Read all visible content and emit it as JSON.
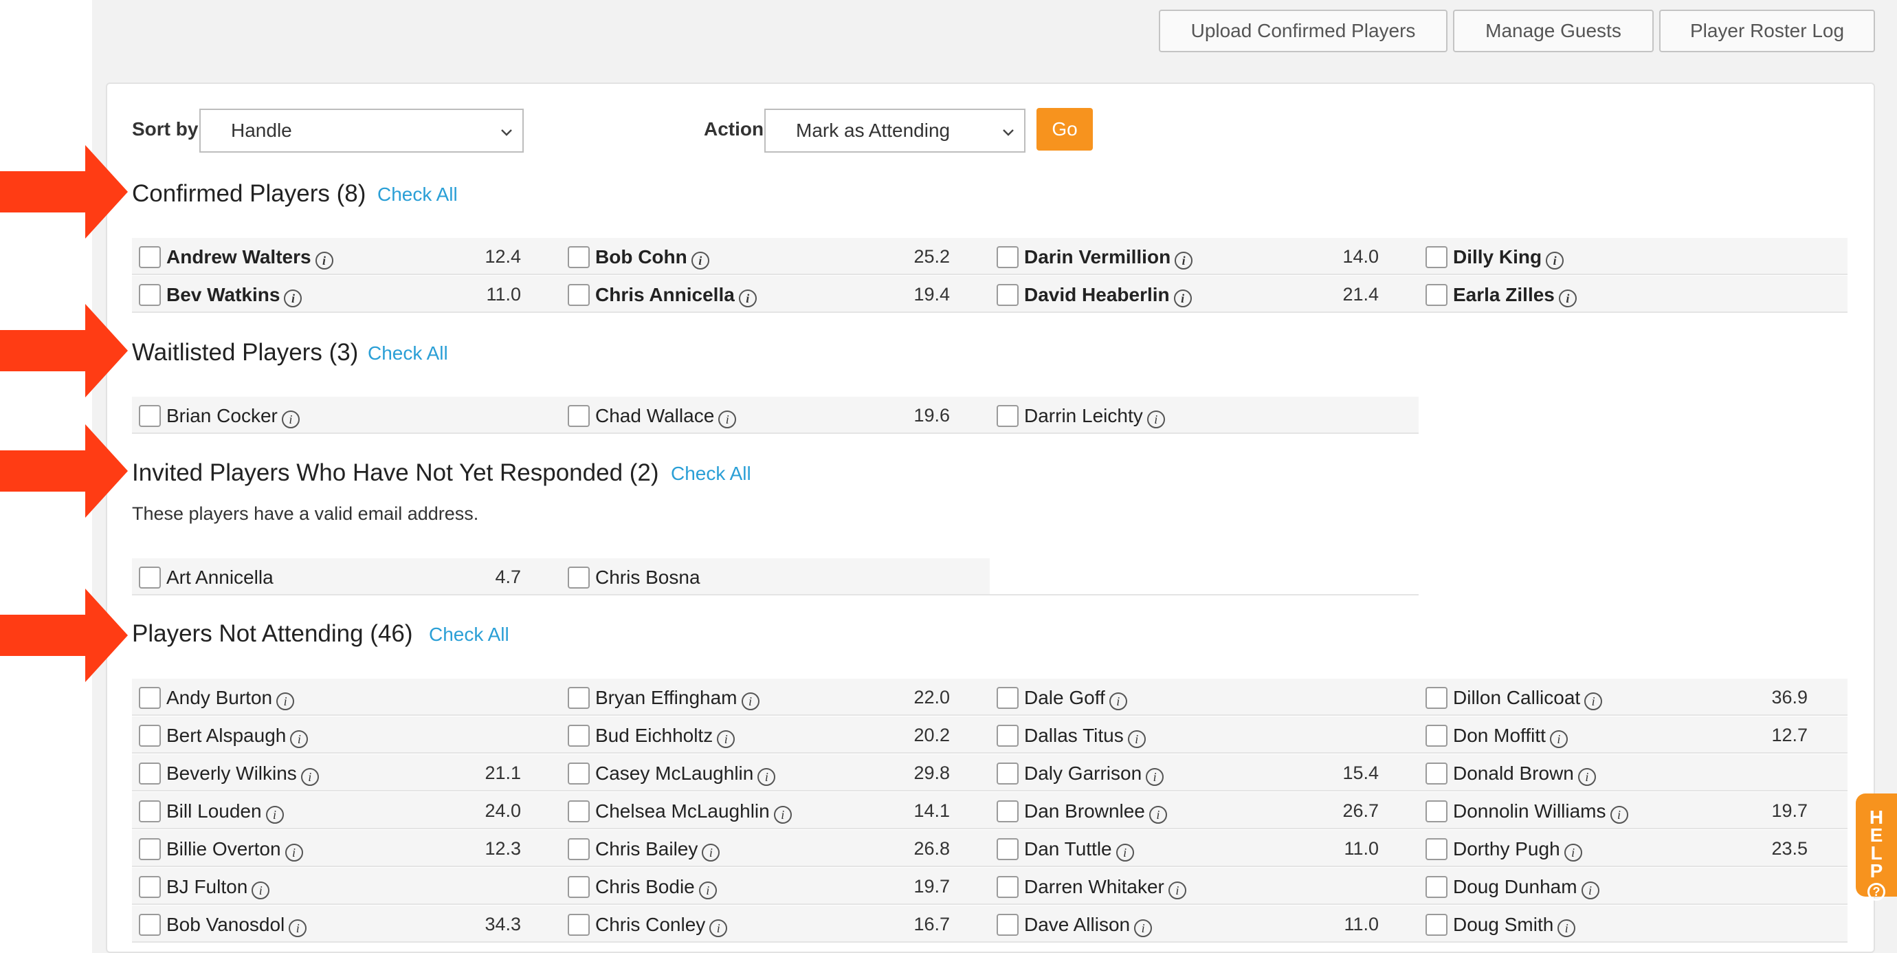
{
  "toolbar": {
    "upload_label": "Upload Confirmed Players",
    "guests_label": "Manage Guests",
    "log_label": "Player Roster Log"
  },
  "controls": {
    "sort_label": "Sort by",
    "sort_value": "Handle",
    "action_label": "Action",
    "action_value": "Mark as Attending",
    "go_label": "Go"
  },
  "check_all_label": "Check All",
  "info_glyph": "i",
  "accent_color": "#f7931e",
  "link_color": "#2a9fd6",
  "arrow_color": "#ff3c14",
  "sections": {
    "confirmed": {
      "title": "Confirmed Players (8)",
      "columns": [
        [
          {
            "name": "Andrew Walters",
            "hcp": "12.4",
            "info": true
          },
          {
            "name": "Bev Watkins",
            "hcp": "11.0",
            "info": true
          }
        ],
        [
          {
            "name": "Bob Cohn",
            "hcp": "25.2",
            "info": true
          },
          {
            "name": "Chris Annicella",
            "hcp": "19.4",
            "info": true
          }
        ],
        [
          {
            "name": "Darin Vermillion",
            "hcp": "14.0",
            "info": true
          },
          {
            "name": "David Heaberlin",
            "hcp": "21.4",
            "info": true
          }
        ],
        [
          {
            "name": "Dilly King",
            "hcp": "",
            "info": true
          },
          {
            "name": "Earla Zilles",
            "hcp": "",
            "info": true
          }
        ]
      ]
    },
    "waitlisted": {
      "title": "Waitlisted Players (3)",
      "columns": [
        [
          {
            "name": "Brian Cocker",
            "hcp": "",
            "info": true
          }
        ],
        [
          {
            "name": "Chad Wallace",
            "hcp": "19.6",
            "info": true
          }
        ],
        [
          {
            "name": "Darrin Leichty",
            "hcp": "",
            "info": true
          }
        ]
      ]
    },
    "invited": {
      "title": "Invited Players Who Have Not Yet Responded (2)",
      "note": "These players have a valid email address.",
      "columns": [
        [
          {
            "name": "Art Annicella",
            "hcp": "4.7",
            "info": false
          }
        ],
        [
          {
            "name": "Chris Bosna",
            "hcp": "",
            "info": false
          }
        ]
      ]
    },
    "not_attending": {
      "title": "Players Not Attending (46)",
      "columns": [
        [
          {
            "name": "Andy Burton",
            "hcp": "",
            "info": true
          },
          {
            "name": "Bert Alspaugh",
            "hcp": "",
            "info": true
          },
          {
            "name": "Beverly Wilkins",
            "hcp": "21.1",
            "info": true
          },
          {
            "name": "Bill Louden",
            "hcp": "24.0",
            "info": true
          },
          {
            "name": "Billie Overton",
            "hcp": "12.3",
            "info": true
          },
          {
            "name": "BJ Fulton",
            "hcp": "",
            "info": true
          },
          {
            "name": "Bob Vanosdol",
            "hcp": "34.3",
            "info": true
          }
        ],
        [
          {
            "name": "Bryan Effingham",
            "hcp": "22.0",
            "info": true
          },
          {
            "name": "Bud Eichholtz",
            "hcp": "20.2",
            "info": true
          },
          {
            "name": "Casey McLaughlin",
            "hcp": "29.8",
            "info": true
          },
          {
            "name": "Chelsea McLaughlin",
            "hcp": "14.1",
            "info": true
          },
          {
            "name": "Chris Bailey",
            "hcp": "26.8",
            "info": true
          },
          {
            "name": "Chris Bodie",
            "hcp": "19.7",
            "info": true
          },
          {
            "name": "Chris Conley",
            "hcp": "16.7",
            "info": true
          }
        ],
        [
          {
            "name": "Dale Goff",
            "hcp": "",
            "info": true
          },
          {
            "name": "Dallas Titus",
            "hcp": "",
            "info": true
          },
          {
            "name": "Daly Garrison",
            "hcp": "15.4",
            "info": true
          },
          {
            "name": "Dan Brownlee",
            "hcp": "26.7",
            "info": true
          },
          {
            "name": "Dan Tuttle",
            "hcp": "11.0",
            "info": true
          },
          {
            "name": "Darren Whitaker",
            "hcp": "",
            "info": true
          },
          {
            "name": "Dave Allison",
            "hcp": "11.0",
            "info": true
          }
        ],
        [
          {
            "name": "Dillon Callicoat",
            "hcp": "36.9",
            "info": true
          },
          {
            "name": "Don Moffitt",
            "hcp": "12.7",
            "info": true
          },
          {
            "name": "Donald Brown",
            "hcp": "",
            "info": true
          },
          {
            "name": "Donnolin Williams",
            "hcp": "19.7",
            "info": true
          },
          {
            "name": "Dorthy Pugh",
            "hcp": "23.5",
            "info": true
          },
          {
            "name": "Doug Dunham",
            "hcp": "",
            "info": true
          },
          {
            "name": "Doug Smith",
            "hcp": "",
            "info": true
          }
        ]
      ]
    }
  },
  "help": {
    "letters": [
      "H",
      "E",
      "L",
      "P"
    ],
    "glyph": "?"
  }
}
